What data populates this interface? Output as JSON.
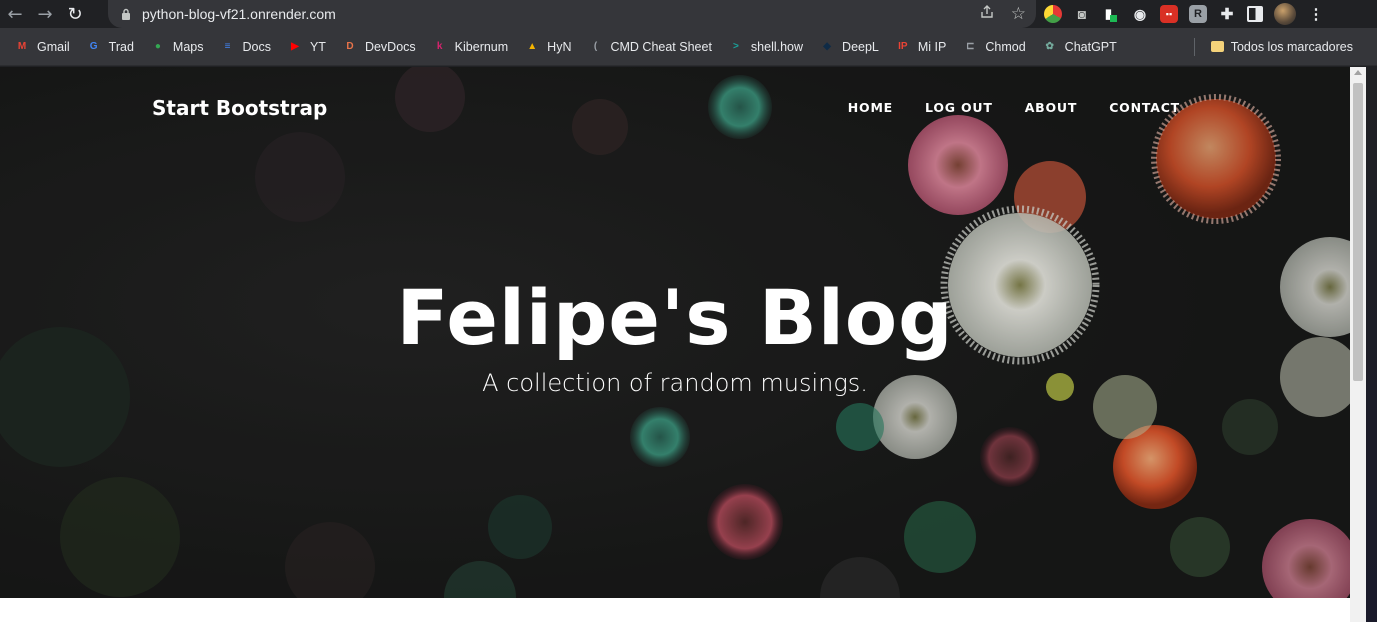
{
  "browser": {
    "url": "python-blog-vf21.onrender.com",
    "bookmarks": [
      {
        "label": "Gmail",
        "icon": "gmail-icon",
        "color": "#ea4335",
        "glyph": "M"
      },
      {
        "label": "Trad",
        "icon": "translate-icon",
        "color": "#4285f4",
        "glyph": "G"
      },
      {
        "label": "Maps",
        "icon": "maps-icon",
        "color": "#34a853",
        "glyph": "●"
      },
      {
        "label": "Docs",
        "icon": "docs-icon",
        "color": "#4285f4",
        "glyph": "≡"
      },
      {
        "label": "YT",
        "icon": "youtube-icon",
        "color": "#ff0000",
        "glyph": "▶"
      },
      {
        "label": "DevDocs",
        "icon": "devdocs-icon",
        "color": "#e8734a",
        "glyph": "D"
      },
      {
        "label": "Kibernum",
        "icon": "kibernum-icon",
        "color": "#d6246e",
        "glyph": "k"
      },
      {
        "label": "HyN",
        "icon": "hyn-icon",
        "color": "#f4b400",
        "glyph": "▲"
      },
      {
        "label": "CMD Cheat Sheet",
        "icon": "cmd-icon",
        "color": "#9aa0a6",
        "glyph": "("
      },
      {
        "label": "shell.how",
        "icon": "shell-icon",
        "color": "#1aa39b",
        "glyph": ">"
      },
      {
        "label": "DeepL",
        "icon": "deepl-icon",
        "color": "#0f2b46",
        "glyph": "◆"
      },
      {
        "label": "Mi IP",
        "icon": "mi-ip-icon",
        "color": "#ea4335",
        "glyph": "IP"
      },
      {
        "label": "Chmod",
        "icon": "chmod-icon",
        "color": "#9aa0a6",
        "glyph": "⊏"
      },
      {
        "label": "ChatGPT",
        "icon": "chatgpt-icon",
        "color": "#74aa9c",
        "glyph": "✿"
      }
    ],
    "all_bookmarks": "Todos los marcadores"
  },
  "site": {
    "brand": "Start Bootstrap",
    "nav": [
      "Home",
      "Log Out",
      "About",
      "Contact"
    ],
    "title": "Felipe's Blog",
    "subtitle": "A collection of random musings."
  }
}
